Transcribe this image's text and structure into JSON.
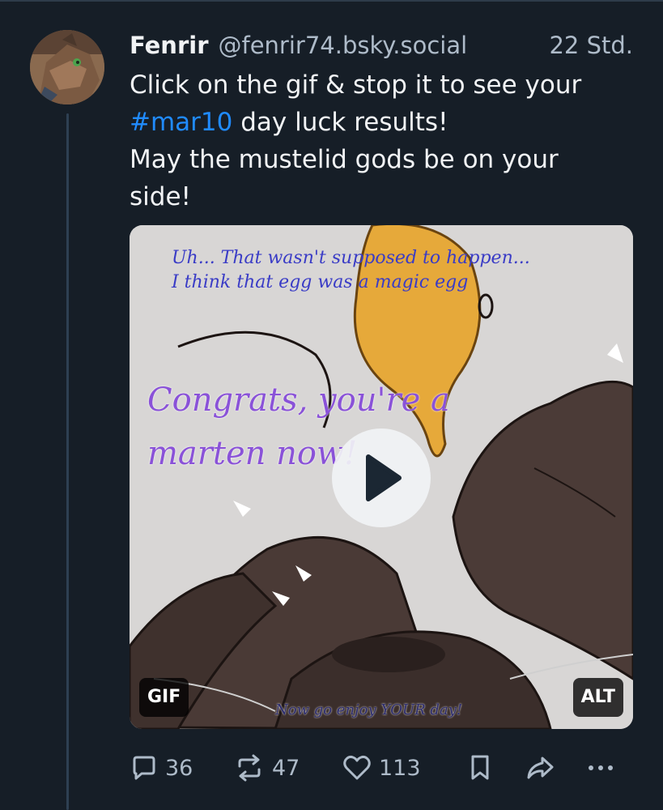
{
  "post": {
    "author_name": "Fenrir",
    "author_handle": "@fenrir74.bsky.social",
    "time": "22 Std.",
    "text_lines": [
      {
        "prefix": "Click on the gif & stop it to see your",
        "hashtag": "",
        "suffix": ""
      },
      {
        "prefix": "",
        "hashtag": "#mar10",
        "suffix": " day luck results!"
      },
      {
        "prefix": "May the mustelid gods be on your",
        "hashtag": "",
        "suffix": ""
      },
      {
        "prefix": "side!",
        "hashtag": "",
        "suffix": ""
      }
    ]
  },
  "media": {
    "caption_line1": "Uh... That wasn't supposed to happen...",
    "caption_line2": "I think that egg was a magic egg",
    "congrats_line1": "Congrats, you're a",
    "congrats_line2": "marten now!",
    "footer_text": "Now go enjoy YOUR day!",
    "gif_badge": "GIF",
    "alt_badge": "ALT",
    "play_icon": "play-icon"
  },
  "actions": {
    "replies": "36",
    "reposts": "47",
    "likes": "113",
    "reply_icon": "reply-icon",
    "repost_icon": "repost-icon",
    "like_icon": "heart-icon",
    "bookmark_icon": "bookmark-icon",
    "share_icon": "share-icon",
    "more_icon": "more-icon"
  },
  "colors": {
    "background": "#161e27",
    "text": "#f1f3f5",
    "muted": "#aebbc9",
    "link": "#208bfe",
    "thread_line": "#2e4052"
  }
}
